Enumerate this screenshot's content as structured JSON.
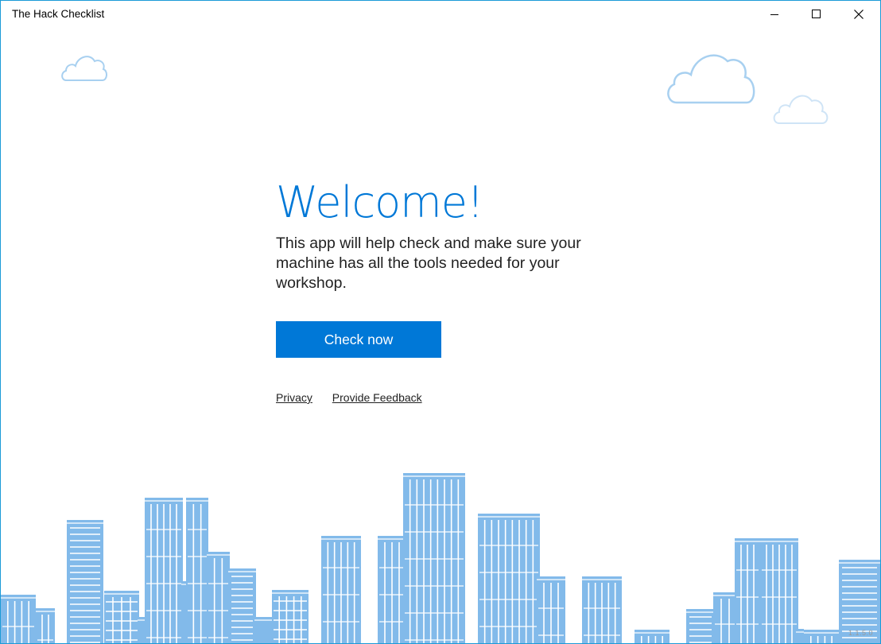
{
  "window": {
    "title": "The Hack Checklist",
    "controls": {
      "minimize_icon": "minimize-icon",
      "maximize_icon": "maximize-icon",
      "close_icon": "close-icon"
    }
  },
  "welcome": {
    "heading": "Welcome!",
    "description": "This app will help check and make sure your machine has all the tools needed for your workshop.",
    "primary_button": "Check now"
  },
  "links": {
    "privacy": "Privacy",
    "feedback": "Provide Feedback"
  },
  "footer": {
    "version": "1.1.5.0"
  },
  "colors": {
    "accent": "#0078d7",
    "building": "#82baea",
    "cloud_outline": "#a8d0f0",
    "window_border": "#1b9bd7"
  }
}
